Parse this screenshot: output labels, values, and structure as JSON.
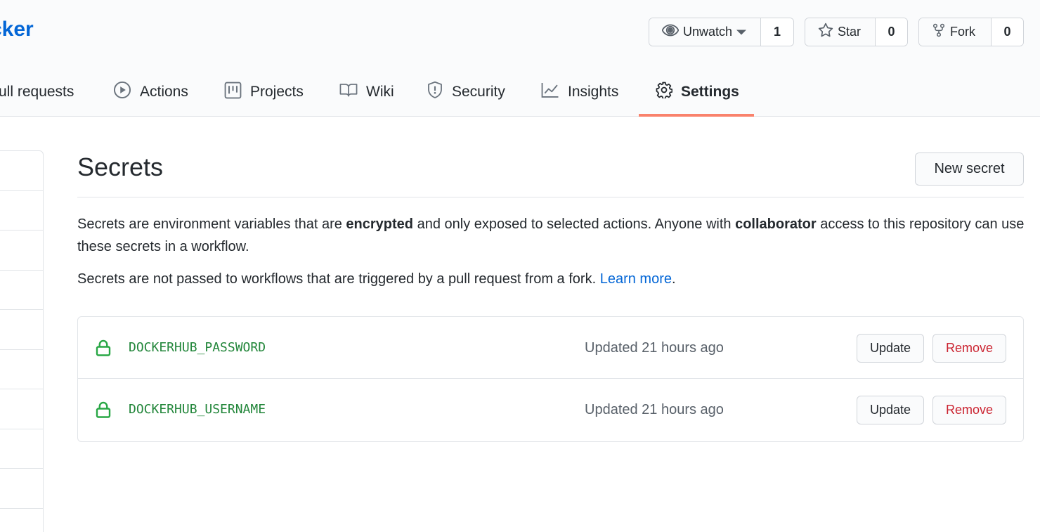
{
  "repo": {
    "name_fragment": "cker"
  },
  "repo_actions": {
    "watch": {
      "label": "Unwatch",
      "count": "1"
    },
    "star": {
      "label": "Star",
      "count": "0"
    },
    "fork": {
      "label": "Fork",
      "count": "0"
    }
  },
  "tabs": [
    {
      "label": "ull requests",
      "icon": "pull-request-icon"
    },
    {
      "label": "Actions",
      "icon": "play-icon"
    },
    {
      "label": "Projects",
      "icon": "project-icon"
    },
    {
      "label": "Wiki",
      "icon": "book-icon"
    },
    {
      "label": "Security",
      "icon": "shield-icon"
    },
    {
      "label": "Insights",
      "icon": "graph-icon"
    },
    {
      "label": "Settings",
      "icon": "gear-icon",
      "selected": true
    }
  ],
  "accent_color": "#f9826c",
  "page": {
    "title": "Secrets",
    "new_secret_label": "New secret",
    "desc1_part1": "Secrets are environment variables that are ",
    "desc1_bold1": "encrypted",
    "desc1_part2": " and only exposed to selected actions. Anyone with ",
    "desc1_bold2": "collaborator",
    "desc1_part3": " access to this repository can use these secrets in a workflow.",
    "desc2_part1": "Secrets are not passed to workflows that are triggered by a pull request from a fork. ",
    "desc2_link": "Learn more",
    "desc2_end": "."
  },
  "secrets": [
    {
      "name": "DOCKERHUB_PASSWORD",
      "updated": "Updated 21 hours ago",
      "update_label": "Update",
      "remove_label": "Remove"
    },
    {
      "name": "DOCKERHUB_USERNAME",
      "updated": "Updated 21 hours ago",
      "update_label": "Update",
      "remove_label": "Remove"
    }
  ]
}
